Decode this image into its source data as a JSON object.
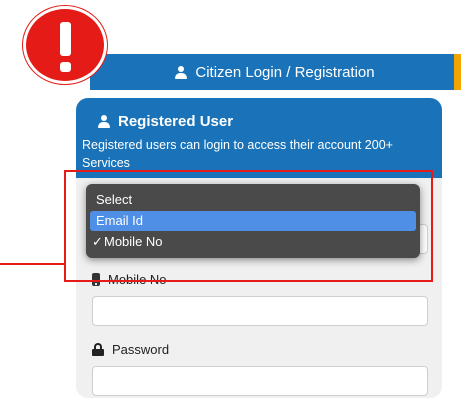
{
  "header": {
    "title": "Citizen Login / Registration",
    "icon": "user-icon"
  },
  "card": {
    "title": "Registered User",
    "description": "Registered users can login to access their account 200+ Services"
  },
  "dropdown": {
    "options": [
      {
        "label": "Select",
        "highlighted": false,
        "checked": false
      },
      {
        "label": "Email Id",
        "highlighted": true,
        "checked": false
      },
      {
        "label": "Mobile No",
        "highlighted": false,
        "checked": true
      }
    ]
  },
  "fields": {
    "mobile_label": "Mobile No",
    "password_label": "Password"
  },
  "colors": {
    "primary": "#1a73b8",
    "warning": "#e41b17",
    "highlight": "#4f8fe6",
    "accent": "#f0a500"
  },
  "warning_icon": "exclamation-icon"
}
